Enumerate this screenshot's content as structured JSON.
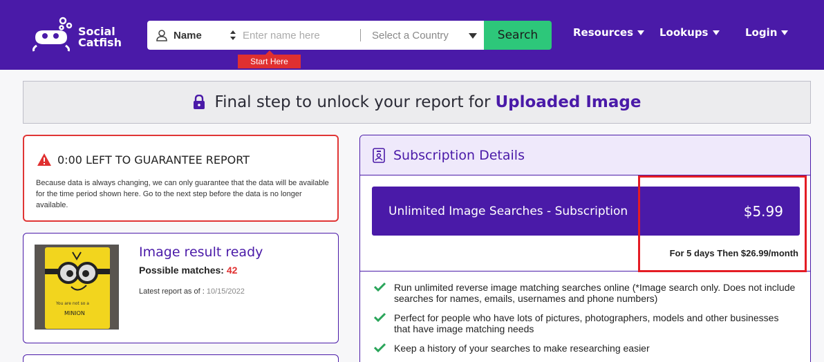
{
  "header": {
    "logo_line1": "Social",
    "logo_line2": "Catfish",
    "search_type": "Name",
    "name_placeholder": "Enter name here",
    "country_placeholder": "Select a Country",
    "search_button": "Search",
    "start_here": "Start Here",
    "nav": [
      "Resources",
      "Lookups",
      "Login"
    ]
  },
  "banner": {
    "text": "Final step to unlock your report for",
    "highlight": "Uploaded Image"
  },
  "guarantee": {
    "title": "0:00 LEFT TO GUARANTEE REPORT",
    "body": "Because data is always changing, we can only guarantee that the data will be available for the time period shown here. Go to the next step before the data is no longer available."
  },
  "result": {
    "title": "Image result ready",
    "matches_label": "Possible matches:",
    "matches_count": "42",
    "latest_label": "Latest report as of :",
    "latest_date": "10/15/2022",
    "thumb_caption": "MINION",
    "thumb_small_text": "You are not so a"
  },
  "subscription": {
    "title": "Subscription Details",
    "plan_name": "Unlimited Image Searches - Subscription",
    "price": "$5.99",
    "then_text": "For 5 days Then $26.99/month",
    "features": [
      "Run unlimited reverse image matching searches online (*Image search only. Does not include searches for names, emails, usernames and phone numbers)",
      "Perfect for people who have lots of pictures, photographers, models and other businesses that have image matching needs",
      "Keep a history of your searches to make researching easier"
    ]
  },
  "colors": {
    "brand": "#4a1aa8",
    "search": "#2dc77a",
    "alert": "#e03030"
  }
}
